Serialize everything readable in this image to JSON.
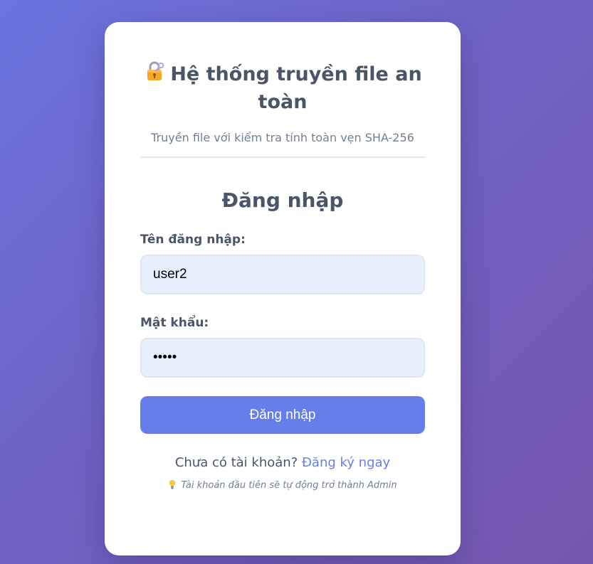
{
  "header": {
    "lock_icon": "lock-with-key-icon",
    "title": "Hệ thống truyền file an toàn",
    "subtitle": "Truyền file với kiểm tra tính toàn vẹn SHA-256"
  },
  "form": {
    "title": "Đăng nhập",
    "username_label": "Tên đăng nhập:",
    "username_value": "user2",
    "password_label": "Mật khẩu:",
    "password_value": "•••••",
    "submit_label": "Đăng nhập"
  },
  "footer": {
    "register_prompt": "Chưa có tài khoản?",
    "register_link": "Đăng ký ngay",
    "hint_icon": "light-bulb-icon",
    "hint": "Tài khoản đầu tiên sẽ tự động trở thành Admin"
  },
  "colors": {
    "accent": "#667eea",
    "heading": "#4a5568",
    "muted": "#718096",
    "input_bg": "#e8f0fe"
  }
}
